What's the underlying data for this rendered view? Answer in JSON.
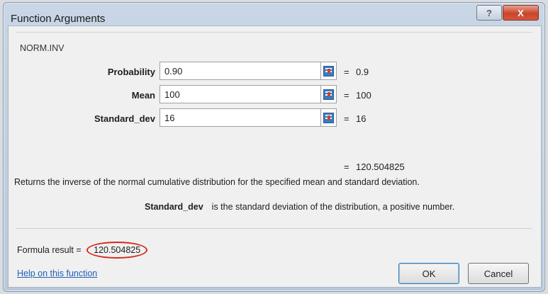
{
  "window": {
    "title": "Function Arguments",
    "help_glyph": "?",
    "close_glyph": "X"
  },
  "function_name": "NORM.INV",
  "arguments": [
    {
      "label": "Probability",
      "value": "0.90",
      "evaluated": "0.9"
    },
    {
      "label": "Mean",
      "value": "100",
      "evaluated": "100"
    },
    {
      "label": "Standard_dev",
      "value": "16",
      "evaluated": "16"
    }
  ],
  "equals": "=",
  "result": {
    "value": "120.504825"
  },
  "description": "Returns the inverse of the normal cumulative distribution for the specified mean and standard deviation.",
  "param_help": {
    "name": "Standard_dev",
    "text": "is the standard deviation of the distribution, a positive number."
  },
  "formula_result": {
    "label": "Formula result =",
    "value": "120.504825",
    "highlight_color": "#d62a1f"
  },
  "help_link": "Help on this function",
  "buttons": {
    "ok": "OK",
    "cancel": "Cancel"
  },
  "icons": {
    "ref_button": "range-select-icon"
  }
}
